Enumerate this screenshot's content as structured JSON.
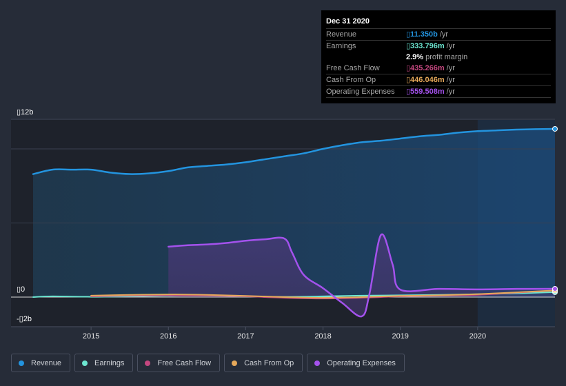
{
  "tooltip": {
    "date": "Dec 31 2020",
    "rows": [
      {
        "label": "Revenue",
        "value": "11.350b",
        "unit": " /yr",
        "color": "#2394df"
      },
      {
        "label": "Earnings",
        "value": "333.796m",
        "unit": " /yr",
        "color": "#6ce5d0"
      },
      {
        "label": "",
        "value": "2.9%",
        "unit": " profit margin",
        "color": "#ffffff"
      },
      {
        "label": "Free Cash Flow",
        "value": "435.266m",
        "unit": " /yr",
        "color": "#c4477f"
      },
      {
        "label": "Cash From Op",
        "value": "446.046m",
        "unit": " /yr",
        "color": "#e6a95a"
      },
      {
        "label": "Operating Expenses",
        "value": "559.508m",
        "unit": " /yr",
        "color": "#a452ed"
      }
    ],
    "currency_glyph": "▯"
  },
  "legend": [
    {
      "label": "Revenue",
      "color": "#2394df"
    },
    {
      "label": "Earnings",
      "color": "#6ce5d0"
    },
    {
      "label": "Free Cash Flow",
      "color": "#c4477f"
    },
    {
      "label": "Cash From Op",
      "color": "#e6a95a"
    },
    {
      "label": "Operating Expenses",
      "color": "#a452ed"
    }
  ],
  "chart_data": {
    "type": "area",
    "title": "",
    "xlabel": "",
    "ylabel": "",
    "y_unit": "b",
    "ylim": [
      -2,
      12
    ],
    "xlim": [
      2014.25,
      2021.0
    ],
    "y_ticks": [
      {
        "value": 12,
        "label": "▯12b"
      },
      {
        "value": 0,
        "label": "▯0"
      },
      {
        "value": -2,
        "label": "-▯2b"
      }
    ],
    "x_ticks": [
      2015,
      2016,
      2017,
      2018,
      2019,
      2020
    ],
    "forecast_shade_start": 2020.0,
    "grid": true,
    "legend_position": "bottom",
    "series": [
      {
        "name": "Revenue",
        "color": "#2394df",
        "x": [
          2014.25,
          2014.5,
          2014.75,
          2015.0,
          2015.25,
          2015.5,
          2015.75,
          2016.0,
          2016.25,
          2016.5,
          2016.75,
          2017.0,
          2017.25,
          2017.5,
          2017.75,
          2018.0,
          2018.25,
          2018.5,
          2018.75,
          2019.0,
          2019.25,
          2019.5,
          2019.75,
          2020.0,
          2020.25,
          2020.5,
          2020.75,
          2021.0
        ],
        "y": [
          8.3,
          8.6,
          8.6,
          8.6,
          8.4,
          8.3,
          8.35,
          8.5,
          8.75,
          8.85,
          8.95,
          9.1,
          9.3,
          9.5,
          9.7,
          10.0,
          10.25,
          10.45,
          10.55,
          10.7,
          10.85,
          10.95,
          11.1,
          11.2,
          11.25,
          11.3,
          11.33,
          11.35
        ]
      },
      {
        "name": "Earnings",
        "color": "#6ce5d0",
        "x": [
          2014.25,
          2014.5,
          2015.0,
          2015.5,
          2016.0,
          2016.5,
          2017.0,
          2017.5,
          2018.0,
          2018.5,
          2019.0,
          2019.5,
          2020.0,
          2020.5,
          2021.0
        ],
        "y": [
          0.0,
          0.05,
          0.02,
          0.05,
          0.1,
          0.12,
          0.05,
          0.02,
          0.05,
          0.1,
          0.12,
          0.15,
          0.2,
          0.25,
          0.33
        ]
      },
      {
        "name": "Free Cash Flow",
        "color": "#c4477f",
        "x": [
          2015.0,
          2015.5,
          2016.0,
          2016.5,
          2017.0,
          2017.5,
          2018.0,
          2018.5,
          2019.0,
          2019.5,
          2020.0,
          2020.5,
          2021.0
        ],
        "y": [
          0.05,
          0.1,
          0.12,
          0.1,
          0.05,
          -0.05,
          -0.1,
          -0.05,
          0.05,
          0.1,
          0.15,
          0.3,
          0.44
        ]
      },
      {
        "name": "Cash From Op",
        "color": "#e6a95a",
        "x": [
          2015.0,
          2015.5,
          2016.0,
          2016.5,
          2017.0,
          2017.5,
          2018.0,
          2018.5,
          2019.0,
          2019.5,
          2020.0,
          2020.5,
          2021.0
        ],
        "y": [
          0.1,
          0.15,
          0.18,
          0.15,
          0.08,
          0.0,
          -0.05,
          0.0,
          0.08,
          0.12,
          0.2,
          0.32,
          0.45
        ]
      },
      {
        "name": "Operating Expenses",
        "color": "#a452ed",
        "x": [
          2016.0,
          2016.25,
          2016.5,
          2016.75,
          2017.0,
          2017.25,
          2017.5,
          2017.6,
          2017.75,
          2018.0,
          2018.25,
          2018.5,
          2018.6,
          2018.75,
          2018.9,
          2019.0,
          2019.5,
          2020.0,
          2020.5,
          2021.0
        ],
        "y": [
          3.4,
          3.5,
          3.55,
          3.65,
          3.8,
          3.9,
          3.95,
          3.0,
          1.5,
          0.6,
          -0.4,
          -1.3,
          0.2,
          4.2,
          2.2,
          0.5,
          0.55,
          0.52,
          0.55,
          0.56
        ]
      }
    ]
  }
}
